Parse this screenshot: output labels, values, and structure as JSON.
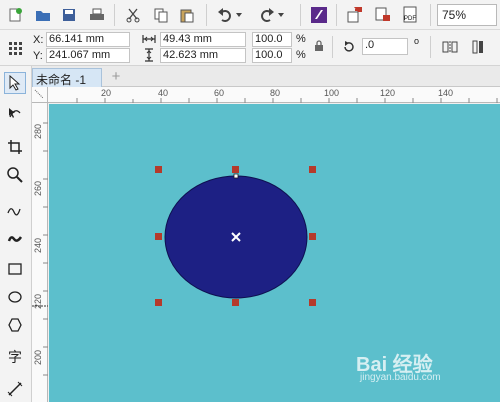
{
  "toolbar": {
    "zoom_value": "75%",
    "buttons": [
      "new-document",
      "open",
      "save",
      "print",
      "cut",
      "copy",
      "paste",
      "undo",
      "redo",
      "app-launcher",
      "import",
      "export",
      "publish-pdf"
    ]
  },
  "property_bar": {
    "x_label": "X:",
    "x_value": "66.141 mm",
    "y_label": "Y:",
    "y_value": "241.067 mm",
    "width_value": "49.43 mm",
    "height_value": "42.623 mm",
    "scale_x": "100.0",
    "scale_y": "100.0",
    "percent": "%",
    "rotation_value": ".0",
    "degree": "o"
  },
  "document": {
    "tab_title": "未命名 -1",
    "add_tab": "+"
  },
  "ruler": {
    "horizontal_labels": [
      "20",
      "40",
      "60",
      "80",
      "100",
      "120",
      "140"
    ],
    "vertical_labels": [
      "280",
      "260",
      "240",
      "220",
      "200"
    ]
  },
  "canvas": {
    "background_color": "#5cbfcc",
    "ellipse_color": "#1d2084",
    "handle_color": "#b53a2b"
  },
  "watermark": {
    "main": "Bai 经验",
    "sub": "jingyan.baidu.com"
  }
}
